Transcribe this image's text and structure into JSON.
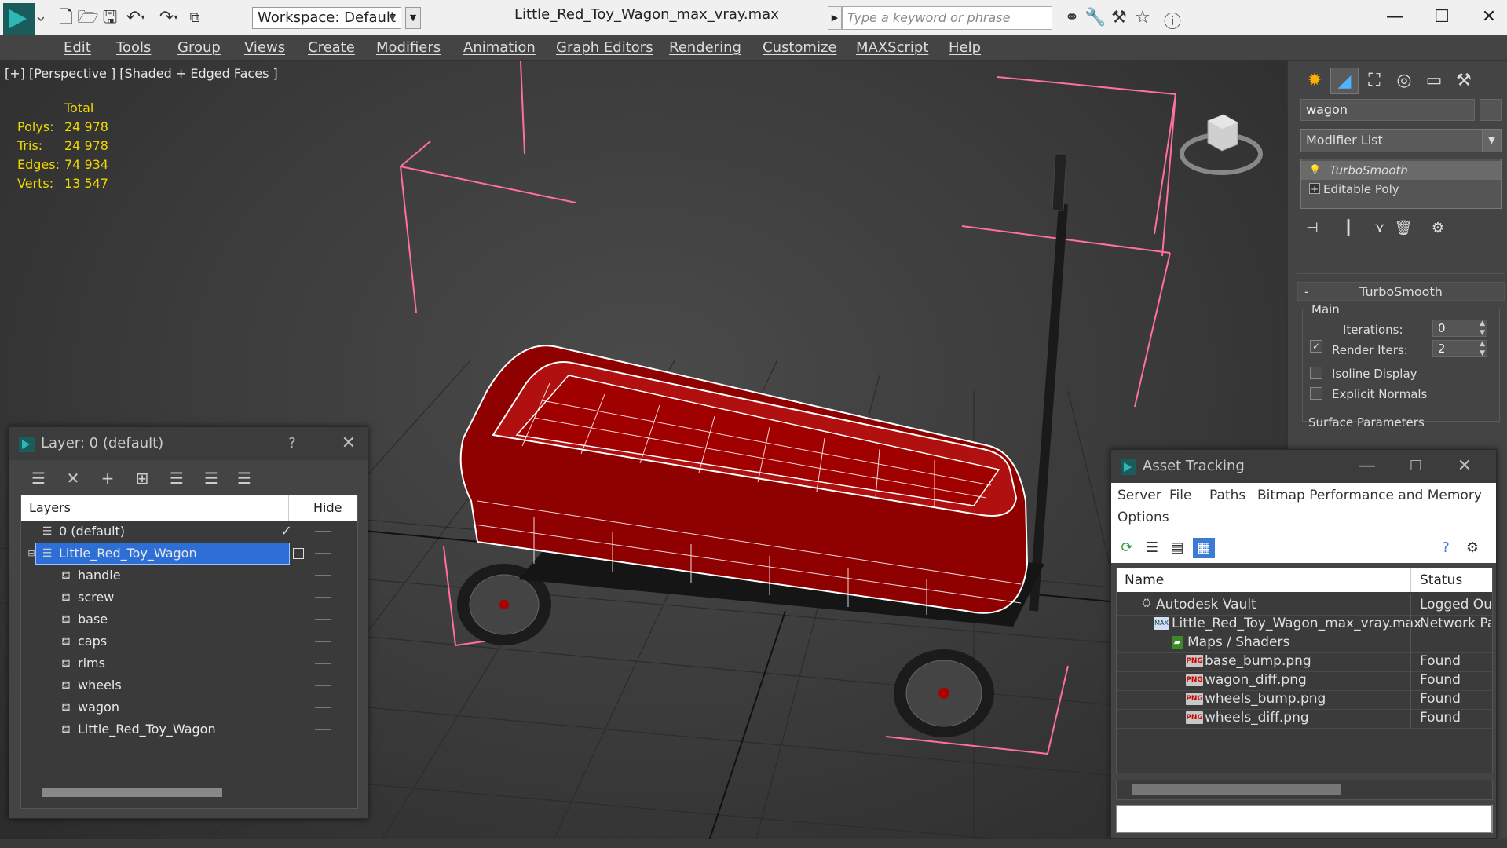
{
  "titlebar": {
    "workspace": "Workspace: Default",
    "file_title": "Little_Red_Toy_Wagon_max_vray.max",
    "search_placeholder": "Type a keyword or phrase"
  },
  "menu": [
    "Edit",
    "Tools",
    "Group",
    "Views",
    "Create",
    "Modifiers",
    "Animation",
    "Graph Editors",
    "Rendering",
    "Customize",
    "MAXScript",
    "Help"
  ],
  "viewport": {
    "label": "[+] [Perspective ] [Shaded + Edged Faces ]",
    "stats_header": "Total",
    "stats": [
      {
        "label": "Polys:",
        "value": "24 978"
      },
      {
        "label": "Tris:",
        "value": "24 978"
      },
      {
        "label": "Edges:",
        "value": "74 934"
      },
      {
        "label": "Verts:",
        "value": "13 547"
      }
    ]
  },
  "command_panel": {
    "object_name": "wagon",
    "modifier_list": "Modifier List",
    "stack": [
      "TurboSmooth",
      "Editable Poly"
    ],
    "rollout_title": "TurboSmooth",
    "main_group": "Main",
    "iterations_label": "Iterations:",
    "iterations_value": "0",
    "render_iters_label": "Render Iters:",
    "render_iters_value": "2",
    "isoline_label": "Isoline Display",
    "explicit_normals_label": "Explicit Normals",
    "surface_params_label": "Surface Parameters"
  },
  "layer_window": {
    "title": "Layer: 0 (default)",
    "help": "?",
    "col_layers": "Layers",
    "col_hide": "Hide",
    "rows": [
      {
        "name": "0 (default)",
        "level": 0,
        "type": "layer"
      },
      {
        "name": "Little_Red_Toy_Wagon",
        "level": 0,
        "type": "layer",
        "selected": true
      },
      {
        "name": "handle",
        "level": 1,
        "type": "object"
      },
      {
        "name": "screw",
        "level": 1,
        "type": "object"
      },
      {
        "name": "base",
        "level": 1,
        "type": "object"
      },
      {
        "name": "caps",
        "level": 1,
        "type": "object"
      },
      {
        "name": "rims",
        "level": 1,
        "type": "object"
      },
      {
        "name": "wheels",
        "level": 1,
        "type": "object"
      },
      {
        "name": "wagon",
        "level": 1,
        "type": "object"
      },
      {
        "name": "Little_Red_Toy_Wagon",
        "level": 1,
        "type": "object"
      }
    ]
  },
  "asset_window": {
    "title": "Asset Tracking",
    "menu": [
      "Server",
      "File",
      "Paths",
      "Bitmap Performance and Memory",
      "Options"
    ],
    "col_name": "Name",
    "col_status": "Status",
    "rows": [
      {
        "name": "Autodesk Vault",
        "status": "Logged Ou",
        "level": 1,
        "icon": "vault-icon"
      },
      {
        "name": "Little_Red_Toy_Wagon_max_vray.max",
        "status": "Network Pa",
        "level": 2,
        "icon": "max-file-icon"
      },
      {
        "name": "Maps / Shaders",
        "status": "",
        "level": 3,
        "icon": "maps-icon"
      },
      {
        "name": "base_bump.png",
        "status": "Found",
        "level": 4,
        "icon": "png-icon"
      },
      {
        "name": "wagon_diff.png",
        "status": "Found",
        "level": 4,
        "icon": "png-icon"
      },
      {
        "name": "wheels_bump.png",
        "status": "Found",
        "level": 4,
        "icon": "png-icon"
      },
      {
        "name": "wheels_diff.png",
        "status": "Found",
        "level": 4,
        "icon": "png-icon"
      }
    ]
  },
  "colors": {
    "accent": "#2d6fd6",
    "stats": "#f0d900",
    "wagon": "#9a0000",
    "bbox": "#ff6fa0"
  }
}
